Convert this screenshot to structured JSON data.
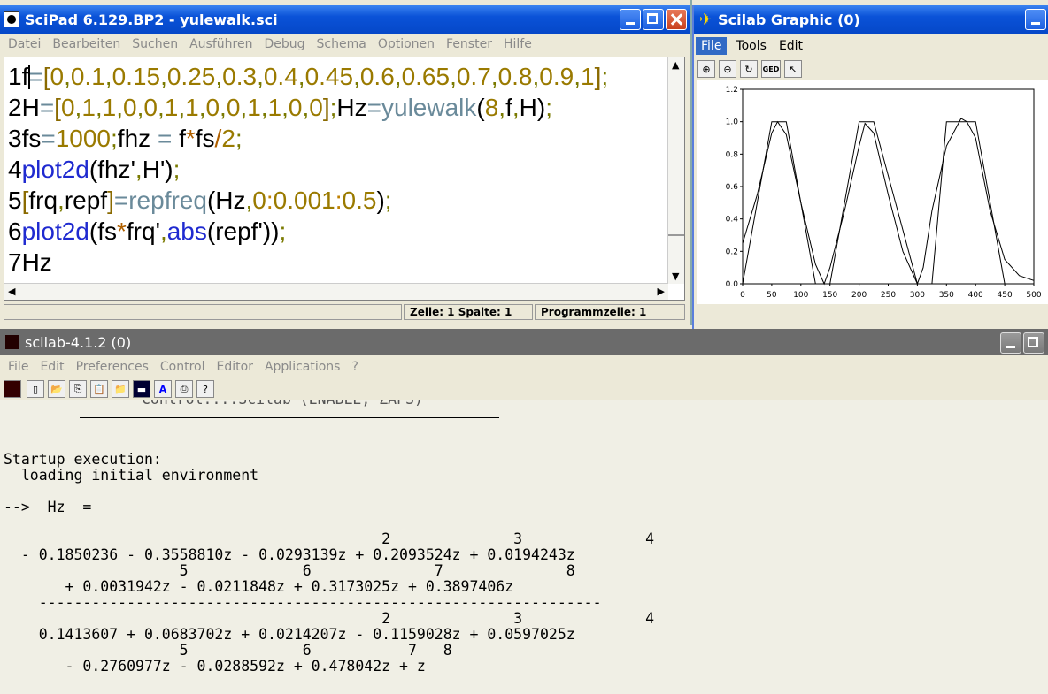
{
  "scipad": {
    "title": "SciPad 6.129.BP2 - yulewalk.sci",
    "menu": [
      "Datei",
      "Bearbeiten",
      "Suchen",
      "Ausführen",
      "Debug",
      "Schema",
      "Optionen",
      "Fenster",
      "Hilfe"
    ],
    "lines": [
      {
        "num": "1",
        "text": "f=[0,0.1,0.15,0.25,0.3,0.4,0.45,0.6,0.65,0.7,0.8,0.9,1];"
      },
      {
        "num": "2",
        "text": "H=[0,1,1,0,0,1,1,0,0,1,1,0,0];Hz=yulewalk(8,f,H);"
      },
      {
        "num": "3",
        "text": "fs=1000;fhz = f*fs/2;"
      },
      {
        "num": "4",
        "text": "plot2d(fhz',H');"
      },
      {
        "num": "5",
        "text": "[frq,repf]=repfreq(Hz,0:0.001:0.5);"
      },
      {
        "num": "6",
        "text": "plot2d(fs*frq',abs(repf'));"
      },
      {
        "num": "7",
        "text": "Hz"
      }
    ],
    "status": {
      "position": "Zeile: 1 Spalte: 1",
      "program_line": "Programmzeile: 1"
    }
  },
  "graphic": {
    "title": "Scilab Graphic (0)",
    "menu": [
      "File",
      "Tools",
      "Edit"
    ],
    "tool_ged": "GED"
  },
  "console": {
    "title": "scilab-4.1.2 (0)",
    "menu": [
      "File",
      "Edit",
      "Preferences",
      "Control",
      "Editor",
      "Applications",
      "?"
    ],
    "partial_line": "Control....Scilab (ENABLE, ZAPS)",
    "lines": {
      "startup": "Startup execution:",
      "loading": "  loading initial environment",
      "prompt": "-->  Hz  =",
      "num_exp1": "                                           2              3              4",
      "num_line1": "  - 0.1850236 - 0.3558810z - 0.0293139z + 0.2093524z + 0.0194243z",
      "num_exp2": "                    5             6              7              8",
      "num_line2": "       + 0.0031942z - 0.0211848z + 0.3173025z + 0.3897406z",
      "divider": "    ----------------------------------------------------------------",
      "den_exp1": "                                           2              3              4",
      "den_line1": "    0.1413607 + 0.0683702z + 0.0214207z - 0.1159028z + 0.0597025z",
      "den_exp2": "                    5             6           7   8",
      "den_line2": "       - 0.2760977z - 0.0288592z + 0.478042z + z"
    }
  },
  "chart_data": {
    "type": "line",
    "xlim": [
      0,
      500
    ],
    "ylim": [
      0,
      1.2
    ],
    "xticks": [
      "0",
      "50",
      "100",
      "150",
      "200",
      "250",
      "300",
      "350",
      "400",
      "450",
      "500"
    ],
    "yticks": [
      "0.0",
      "0.2",
      "0.4",
      "0.6",
      "0.8",
      "1.0",
      "1.2"
    ],
    "series": [
      {
        "x": [
          0,
          50,
          75,
          125,
          150,
          200,
          225,
          300,
          325,
          350,
          400,
          450,
          500
        ],
        "values": [
          0,
          1,
          1,
          0,
          0,
          1,
          1,
          0,
          0,
          1,
          1,
          0,
          0
        ]
      },
      {
        "x": [
          0,
          25,
          50,
          60,
          75,
          100,
          125,
          140,
          150,
          175,
          200,
          210,
          225,
          250,
          275,
          300,
          310,
          325,
          350,
          375,
          385,
          400,
          425,
          450,
          475,
          500
        ],
        "values": [
          0.25,
          0.55,
          0.93,
          1.0,
          0.92,
          0.5,
          0.12,
          0.0,
          0.1,
          0.45,
          0.85,
          0.99,
          0.93,
          0.55,
          0.2,
          0.0,
          0.1,
          0.45,
          0.85,
          1.02,
          1.0,
          0.9,
          0.45,
          0.15,
          0.05,
          0.02
        ]
      }
    ]
  }
}
